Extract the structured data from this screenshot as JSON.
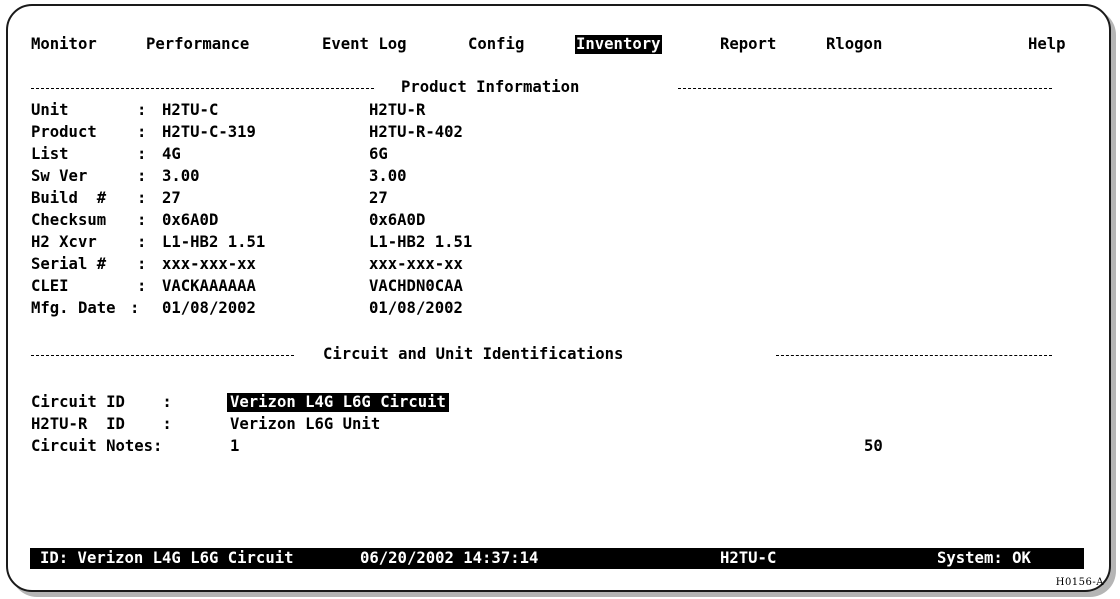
{
  "menu": {
    "items": [
      "Monitor",
      "Performance",
      "Event Log",
      "Config",
      "Inventory",
      "Report",
      "Rlogon"
    ],
    "active": "Inventory",
    "help": "Help"
  },
  "product_section": {
    "title": "Product Information",
    "rows": [
      {
        "label": "Unit      ",
        "c": "H2TU-C",
        "r": "H2TU-R"
      },
      {
        "label": "Product   ",
        "c": "H2TU-C-319",
        "r": "H2TU-R-402"
      },
      {
        "label": "List      ",
        "c": "4G",
        "r": "6G"
      },
      {
        "label": "Sw Ver    ",
        "c": "3.00",
        "r": "3.00"
      },
      {
        "label": "Build  #  ",
        "c": "27",
        "r": "27"
      },
      {
        "label": "Checksum  ",
        "c": "0x6A0D",
        "r": "0x6A0D"
      },
      {
        "label": "H2 Xcvr   ",
        "c": "L1-HB2 1.51",
        "r": "L1-HB2 1.51"
      },
      {
        "label": "Serial #  ",
        "c": "xxx-xxx-xx",
        "r": "xxx-xxx-xx"
      },
      {
        "label": "CLEI      ",
        "c": "VACKAAAAAA",
        "r": "VACHDN0CAA"
      },
      {
        "label": "Mfg. Date",
        "c": "01/08/2002",
        "r": "01/08/2002"
      }
    ]
  },
  "circuit_section": {
    "title": "Circuit and Unit Identifications",
    "circuit_id_label": "Circuit ID    :",
    "circuit_id": "Verizon L4G L6G Circuit",
    "unit_id_label": "H2TU-R  ID    :",
    "unit_id": "Verizon L6G Unit",
    "notes_label": "Circuit Notes:",
    "notes": "1",
    "notes_max": "50"
  },
  "status_bar": {
    "id": "ID: Verizon L4G L6G Circuit",
    "datetime": "06/20/2002 14:37:14",
    "unit": "H2TU-C",
    "system": "System: OK"
  },
  "figure_tag": "H0156-A"
}
